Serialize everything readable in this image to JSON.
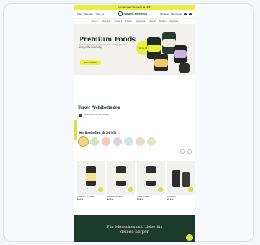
{
  "promo_bar": {
    "text": "Kostenloser Versand ab 40€"
  },
  "top_nav": {
    "left_links": [
      "Shop",
      "Ratgeber",
      "Über uns"
    ],
    "logo_text": "natural elements",
    "right_links": [
      "Beratung",
      "Mein Konto"
    ]
  },
  "category_nav": {
    "items": [
      "Vitamine",
      "Mineralien",
      "Omega 3",
      "Proteine",
      "Superfoods",
      "Kapseln",
      "Bundles",
      "Angebote"
    ]
  },
  "hero": {
    "title": "Premium Foods",
    "subtitle": "Hochwertige Nahrungsergänzung ohne unnötige Zusätze – laborgeprüft und nachhaltig.",
    "cta": "Jetzt entdecken",
    "sticker": "bis zu -20%"
  },
  "wellbeing": {
    "title": "Unser Wohlbefinden",
    "check_text": "Deine Auswahl für mehr Energie"
  },
  "bestsellers": {
    "title": "Die Bestseller ab 24,95€",
    "categories": [
      "Immun",
      "Energie",
      "Schlaf",
      "Haut",
      "Sport",
      "Darm",
      "Stress"
    ],
    "colors": [
      "#f2d48b",
      "#cfe6c2",
      "#f6c8b8",
      "#d8d4ea",
      "#cfe7e8",
      "#e6dfc8",
      "#e4e7c4"
    ]
  },
  "products": [
    {
      "name": "Vitamin D3 + K2 Tropfen",
      "price": "24,95 €"
    },
    {
      "name": "Magnesium Komplex",
      "price": "22,95 €"
    },
    {
      "name": "Omega 3 Algenöl",
      "price": "29,95 €"
    },
    {
      "name": "Multivitamin",
      "price": "27,95 €"
    }
  ],
  "footer": {
    "title_line1": "Für Menschen mit Liebe für",
    "title_line2": "deinen Körper"
  }
}
